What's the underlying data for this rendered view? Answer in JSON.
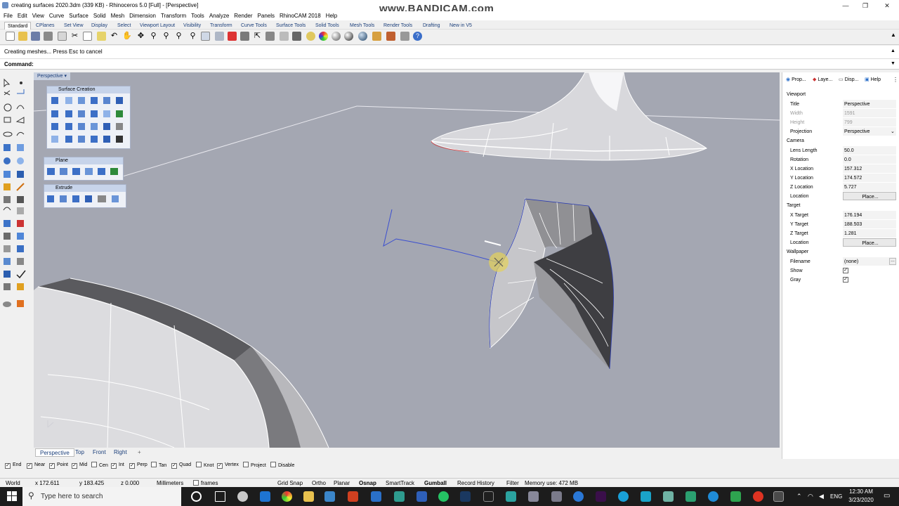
{
  "window": {
    "title": "creating surfaces 2020.3dm (339 KB) - Rhinoceros 5.0 [Full] - [Perspective]",
    "watermark": "www.BANDICAM.com",
    "controls": [
      "—",
      "❐",
      "✕"
    ]
  },
  "menu": [
    "File",
    "Edit",
    "View",
    "Curve",
    "Surface",
    "Solid",
    "Mesh",
    "Dimension",
    "Transform",
    "Tools",
    "Analyze",
    "Render",
    "Panels",
    "RhinoCAM 2018",
    "Help"
  ],
  "tabs": [
    "Standard",
    "CPlanes",
    "Set View",
    "Display",
    "Select",
    "Viewport Layout",
    "Visibility",
    "Transform",
    "Curve Tools",
    "Surface Tools",
    "Solid Tools",
    "Mesh Tools",
    "Render Tools",
    "Drafting",
    "New in V5"
  ],
  "command": {
    "history": "Creating meshes... Press Esc to cancel",
    "prompt": "Command:"
  },
  "viewport": {
    "label": "Perspective",
    "panels": [
      {
        "title": "Surface Creation"
      },
      {
        "title": "Plane"
      },
      {
        "title": "Extrude"
      }
    ]
  },
  "view_tabs": [
    "Perspective",
    "Top",
    "Front",
    "Right"
  ],
  "osnaps": [
    {
      "label": "End",
      "checked": true
    },
    {
      "label": "Near",
      "checked": true
    },
    {
      "label": "Point",
      "checked": true
    },
    {
      "label": "Mid",
      "checked": true
    },
    {
      "label": "Cen",
      "checked": false
    },
    {
      "label": "Int",
      "checked": true
    },
    {
      "label": "Perp",
      "checked": true
    },
    {
      "label": "Tan",
      "checked": false
    },
    {
      "label": "Quad",
      "checked": true
    },
    {
      "label": "Knot",
      "checked": false
    },
    {
      "label": "Vertex",
      "checked": true
    },
    {
      "label": "Project",
      "checked": false
    },
    {
      "label": "Disable",
      "checked": false
    }
  ],
  "status": {
    "cplane": "World",
    "x": "x 172.611",
    "y": "y 183.425",
    "z": "z 0.000",
    "units": "Millimeters",
    "layer": "frames",
    "toggles": [
      "Grid Snap",
      "Ortho",
      "Planar",
      "Osnap",
      "SmartTrack",
      "Gumball",
      "Record History",
      "Filter"
    ],
    "memory": "Memory use: 472 MB"
  },
  "properties": {
    "tabs": [
      "Prop...",
      "Laye...",
      "Disp...",
      "Help"
    ],
    "viewport_section": "Viewport",
    "title_label": "Title",
    "title_value": "Perspective",
    "width_label": "Width",
    "width_value": "1591",
    "height_label": "Height",
    "height_value": "799",
    "projection_label": "Projection",
    "projection_value": "Perspective",
    "camera_section": "Camera",
    "lens_label": "Lens Length",
    "lens_value": "50.0",
    "rotation_label": "Rotation",
    "rotation_value": "0.0",
    "xloc_label": "X Location",
    "xloc_value": "157.312",
    "yloc_label": "Y Location",
    "yloc_value": "174.572",
    "zloc_label": "Z Location",
    "zloc_value": "5.727",
    "location_label": "Location",
    "place_button": "Place...",
    "target_section": "Target",
    "xt_label": "X Target",
    "xt_value": "176.194",
    "yt_label": "Y Target",
    "yt_value": "188.503",
    "zt_label": "Z Target",
    "zt_value": "1.281",
    "tloc_label": "Location",
    "tplace_button": "Place...",
    "wallpaper_section": "Wallpaper",
    "filename_label": "Filename",
    "filename_value": "(none)",
    "show_label": "Show",
    "show_checked": true,
    "gray_label": "Gray",
    "gray_checked": true
  },
  "taskbar": {
    "search_placeholder": "Type here to search",
    "lang": "ENG",
    "time": "12:30 AM",
    "date": "3/23/2020"
  }
}
